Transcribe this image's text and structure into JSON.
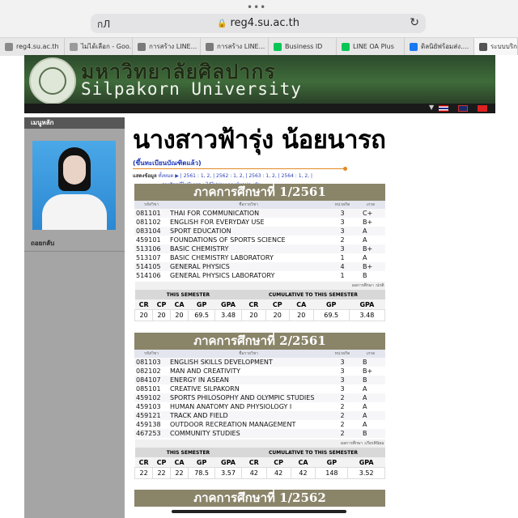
{
  "browser": {
    "left_label": "กЛ",
    "url": "reg4.su.ac.th",
    "tabs": [
      {
        "label": "reg4.su.ac.th",
        "color": "#8a8a8a"
      },
      {
        "label": "ไม่ได้เลือก - Goo...",
        "color": "#9a9a9a"
      },
      {
        "label": "การสร้าง LINE...",
        "color": "#7a7a7a"
      },
      {
        "label": "การสร้าง LINE...",
        "color": "#7a7a7a"
      },
      {
        "label": "Business ID",
        "color": "#06c755"
      },
      {
        "label": "LINE OA Plus",
        "color": "#06c755"
      },
      {
        "label": "ดิลนิยัฟร้อมส่ง....",
        "color": "#1877f2"
      },
      {
        "label": "ระบบบริการ",
        "color": "#555555"
      }
    ]
  },
  "banner": {
    "thai": "มหาวิทยาลัยศิลปากร",
    "english": "Silpakorn University"
  },
  "sidebar": {
    "menu_title": "เมนูหลัก",
    "logout": "ถอยกลับ"
  },
  "student": {
    "name": "นางสาวฟ้ารุ่ง น้อยนารถ",
    "status": "(ขึ้นทะเบียนบัณฑิตแล้ว)"
  },
  "links": {
    "label": "แสดงข้อมูล",
    "all": "ทั้งหมด",
    "terms": "| 2561 : 1, 2, | 2562 : 1, 2, | 2563 : 1, 2, | 2564 : 1, 2, |",
    "extra": "รายวิชาที่ไม่มีเกรด : ได้ไปผ่านเกณฑ์ผลประเมิน"
  },
  "labels": {
    "col_code": "รหัสวิชา",
    "col_name": "ชื่อรายวิชา",
    "col_credit": "หน่วยกิต",
    "col_grade": "เกรด",
    "this_semester": "THIS SEMESTER",
    "cumulative": "CUMULATIVE TO THIS SEMESTER",
    "sum_heads": [
      "CR",
      "CP",
      "CA",
      "GP",
      "GPA",
      "CR",
      "CP",
      "CA",
      "GP",
      "GPA"
    ]
  },
  "semesters": [
    {
      "title": "ภาคการศึกษาที่ 1/2561",
      "result_note": "ผลการศึกษา :ปกติ",
      "courses": [
        {
          "code": "081101",
          "name": "THAI FOR COMMUNICATION",
          "credit": "3",
          "grade": "C+"
        },
        {
          "code": "081102",
          "name": "ENGLISH FOR EVERYDAY USE",
          "credit": "3",
          "grade": "B+"
        },
        {
          "code": "083104",
          "name": "SPORT EDUCATION",
          "credit": "3",
          "grade": "A"
        },
        {
          "code": "459101",
          "name": "FOUNDATIONS OF SPORTS SCIENCE",
          "credit": "2",
          "grade": "A"
        },
        {
          "code": "513106",
          "name": "BASIC CHEMISTRY",
          "credit": "3",
          "grade": "B+"
        },
        {
          "code": "513107",
          "name": "BASIC CHEMISTRY LABORATORY",
          "credit": "1",
          "grade": "A"
        },
        {
          "code": "514105",
          "name": "GENERAL PHYSICS",
          "credit": "4",
          "grade": "B+"
        },
        {
          "code": "514106",
          "name": "GENERAL PHYSICS LABORATORY",
          "credit": "1",
          "grade": "B"
        }
      ],
      "summary": [
        "20",
        "20",
        "20",
        "69.5",
        "3.48",
        "20",
        "20",
        "20",
        "69.5",
        "3.48"
      ]
    },
    {
      "title": "ภาคการศึกษาที่ 2/2561",
      "result_note": "ผลการศึกษา :เกียรตินิยม",
      "courses": [
        {
          "code": "081103",
          "name": "ENGLISH SKILLS DEVELOPMENT",
          "credit": "3",
          "grade": "B"
        },
        {
          "code": "082102",
          "name": "MAN AND CREATIVITY",
          "credit": "3",
          "grade": "B+"
        },
        {
          "code": "084107",
          "name": "ENERGY IN ASEAN",
          "credit": "3",
          "grade": "B"
        },
        {
          "code": "085101",
          "name": "CREATIVE SILPAKORN",
          "credit": "3",
          "grade": "A"
        },
        {
          "code": "459102",
          "name": "SPORTS PHILOSOPHY AND OLYMPIC STUDIES",
          "credit": "2",
          "grade": "A"
        },
        {
          "code": "459103",
          "name": "HUMAN ANATOMY AND PHYSIOLOGY I",
          "credit": "2",
          "grade": "A"
        },
        {
          "code": "459121",
          "name": "TRACK AND FIELD",
          "credit": "2",
          "grade": "A"
        },
        {
          "code": "459138",
          "name": "OUTDOOR RECREATION MANAGEMENT",
          "credit": "2",
          "grade": "A"
        },
        {
          "code": "467253",
          "name": "COMMUNITY STUDIES",
          "credit": "2",
          "grade": "B"
        }
      ],
      "summary": [
        "22",
        "22",
        "22",
        "78.5",
        "3.57",
        "42",
        "42",
        "42",
        "148",
        "3.52"
      ]
    },
    {
      "title": "ภาคการศึกษาที่ 1/2562"
    }
  ]
}
